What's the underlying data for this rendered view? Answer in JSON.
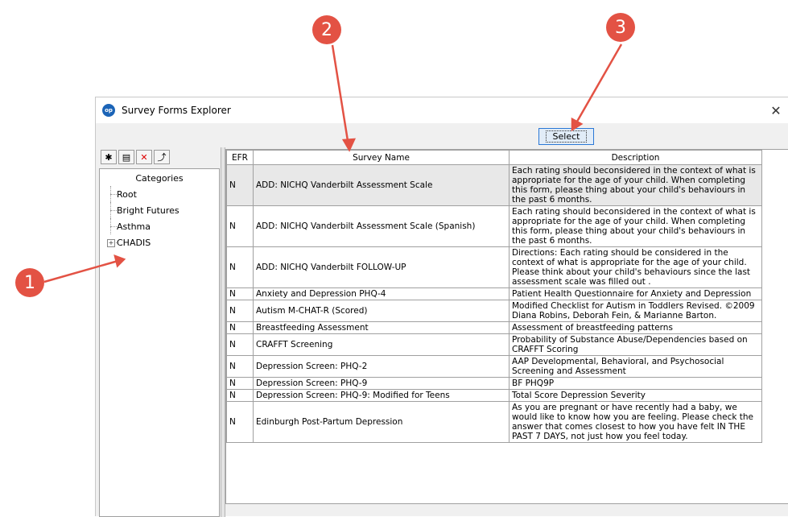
{
  "window": {
    "title": "Survey Forms Explorer",
    "close_symbol": "✕"
  },
  "select_button": {
    "label": "Select"
  },
  "left_panel": {
    "toolbar": [
      {
        "icon": "new-category-icon",
        "glyph": "✱"
      },
      {
        "icon": "properties-icon",
        "glyph": "▤"
      },
      {
        "icon": "delete-icon",
        "glyph": "✕"
      },
      {
        "icon": "folder-up-icon",
        "glyph": "⤴"
      }
    ],
    "tree_header": "Categories",
    "items": [
      "Root",
      "Bright Futures",
      "Asthma",
      "CHADIS"
    ],
    "expander": "+"
  },
  "table": {
    "headers": [
      "EFR",
      "Survey Name",
      "Description"
    ],
    "rows": [
      {
        "efr": "N",
        "name": "ADD: NICHQ Vanderbilt Assessment Scale",
        "desc": "Each rating should beconsidered in the context of what is appropriate for the age of your child.  When completing this form, please thing about your child's behaviours in the past 6 months."
      },
      {
        "efr": "N",
        "name": "ADD: NICHQ Vanderbilt Assessment Scale (Spanish)",
        "desc": "Each rating should beconsidered in the context of what is appropriate for the age of your child.  When completing this form, please thing about your child's behaviours in the past 6 months."
      },
      {
        "efr": "N",
        "name": "ADD: NICHQ Vanderbilt FOLLOW-UP",
        "desc": "Directions:  Each rating should be considered in the context of what is appropriate for the age of your child. Please think about your child's behaviours since the last assessment scale was filled out ."
      },
      {
        "efr": "N",
        "name": "Anxiety and Depression PHQ-4",
        "desc": "Patient Health Questionnaire for Anxiety and Depression"
      },
      {
        "efr": "N",
        "name": "Autism M-CHAT-R (Scored)",
        "desc": "Modified Checklist for Autism in Toddlers Revised. ©2009 Diana Robins, Deborah Fein, & Marianne Barton."
      },
      {
        "efr": "N",
        "name": "Breastfeeding Assessment",
        "desc": "Assessment of breastfeeding patterns"
      },
      {
        "efr": "N",
        "name": "CRAFFT Screening",
        "desc": "Probability of Substance Abuse/Dependencies based on CRAFFT Scoring"
      },
      {
        "efr": "N",
        "name": "Depression Screen: PHQ-2",
        "desc": "AAP Developmental, Behavioral, and Psychosocial Screening and Assessment"
      },
      {
        "efr": "N",
        "name": "Depression Screen: PHQ-9",
        "desc": "BF PHQ9P"
      },
      {
        "efr": "N",
        "name": "Depression Screen: PHQ-9: Modified for Teens",
        "desc": "Total Score Depression Severity"
      },
      {
        "efr": "N",
        "name": "Edinburgh Post-Partum Depression",
        "desc": "As you are pregnant or have recently had a baby, we would like to know how you are feeling. Please check the answer that comes closest to how you have felt IN THE PAST 7 DAYS, not just how you feel today."
      }
    ]
  },
  "callouts": [
    "1",
    "2",
    "3"
  ],
  "colors": {
    "callout": "#e35244",
    "select_border": "#2b78d6"
  }
}
